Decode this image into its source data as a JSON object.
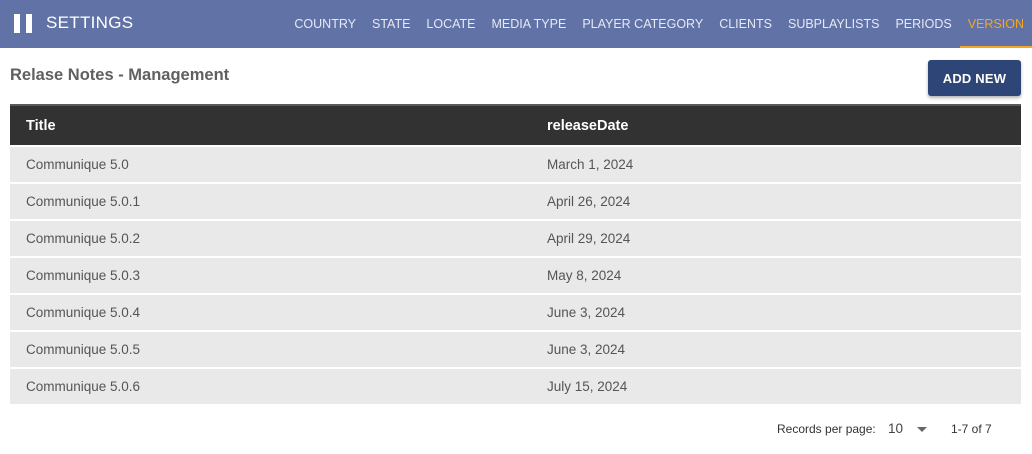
{
  "header": {
    "title": "SETTINGS",
    "nav": [
      {
        "label": "COUNTRY",
        "active": false
      },
      {
        "label": "STATE",
        "active": false
      },
      {
        "label": "LOCATE",
        "active": false
      },
      {
        "label": "MEDIA TYPE",
        "active": false
      },
      {
        "label": "PLAYER CATEGORY",
        "active": false
      },
      {
        "label": "CLIENTS",
        "active": false
      },
      {
        "label": "SUBPLAYLISTS",
        "active": false
      },
      {
        "label": "PERIODS",
        "active": false
      },
      {
        "label": "VERSION",
        "active": true
      }
    ]
  },
  "main": {
    "title": "Relase Notes - Management",
    "add_button": "ADD NEW",
    "table": {
      "columns": [
        "Title",
        "releaseDate"
      ],
      "rows": [
        [
          "Communique 5.0",
          "March 1, 2024"
        ],
        [
          "Communique 5.0.1",
          "April 26, 2024"
        ],
        [
          "Communique 5.0.2",
          "April 29, 2024"
        ],
        [
          "Communique 5.0.3",
          "May 8, 2024"
        ],
        [
          "Communique 5.0.4",
          "June 3, 2024"
        ],
        [
          "Communique 5.0.5",
          "June 3, 2024"
        ],
        [
          "Communique 5.0.6",
          "July 15, 2024"
        ]
      ]
    }
  },
  "pagination": {
    "records_label": "Records per page:",
    "per_page": "10",
    "range": "1-7 of 7"
  },
  "colors": {
    "header_bg": "#6172a6",
    "active_tab": "#f5a623",
    "button_bg": "#2d4677",
    "table_header_bg": "#323232",
    "row_bg": "#e9e9e9"
  }
}
